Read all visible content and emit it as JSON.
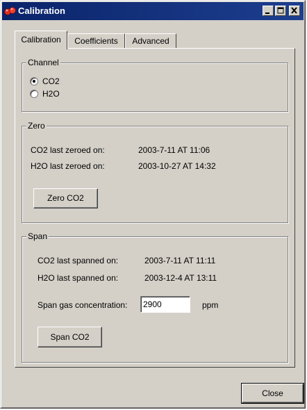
{
  "window": {
    "title": "Calibration"
  },
  "icons": {
    "app": "app-icon",
    "minimize": "minimize-icon",
    "maximize": "maximize-icon",
    "close": "close-icon"
  },
  "tabs": [
    {
      "label": "Calibration",
      "active": true
    },
    {
      "label": "Coefficients",
      "active": false
    },
    {
      "label": "Advanced",
      "active": false
    }
  ],
  "channel": {
    "legend": "Channel",
    "options": [
      {
        "label": "CO2",
        "selected": true
      },
      {
        "label": "H2O",
        "selected": false
      }
    ]
  },
  "zero": {
    "legend": "Zero",
    "co2_label": "CO2 last zeroed on:",
    "co2_value": "2003-7-11 AT 11:06",
    "h2o_label": "H2O last zeroed on:",
    "h2o_value": "2003-10-27 AT 14:32",
    "button": "Zero CO2"
  },
  "span": {
    "legend": "Span",
    "co2_label": "CO2 last spanned on:",
    "co2_value": "2003-7-11 AT 11:11",
    "h2o_label": "H2O last spanned on:",
    "h2o_value": "2003-12-4 AT 13:11",
    "gas_label": "Span gas concentration:",
    "gas_value": "2900",
    "gas_unit": "ppm",
    "button": "Span CO2"
  },
  "footer": {
    "close_button": "Close"
  }
}
